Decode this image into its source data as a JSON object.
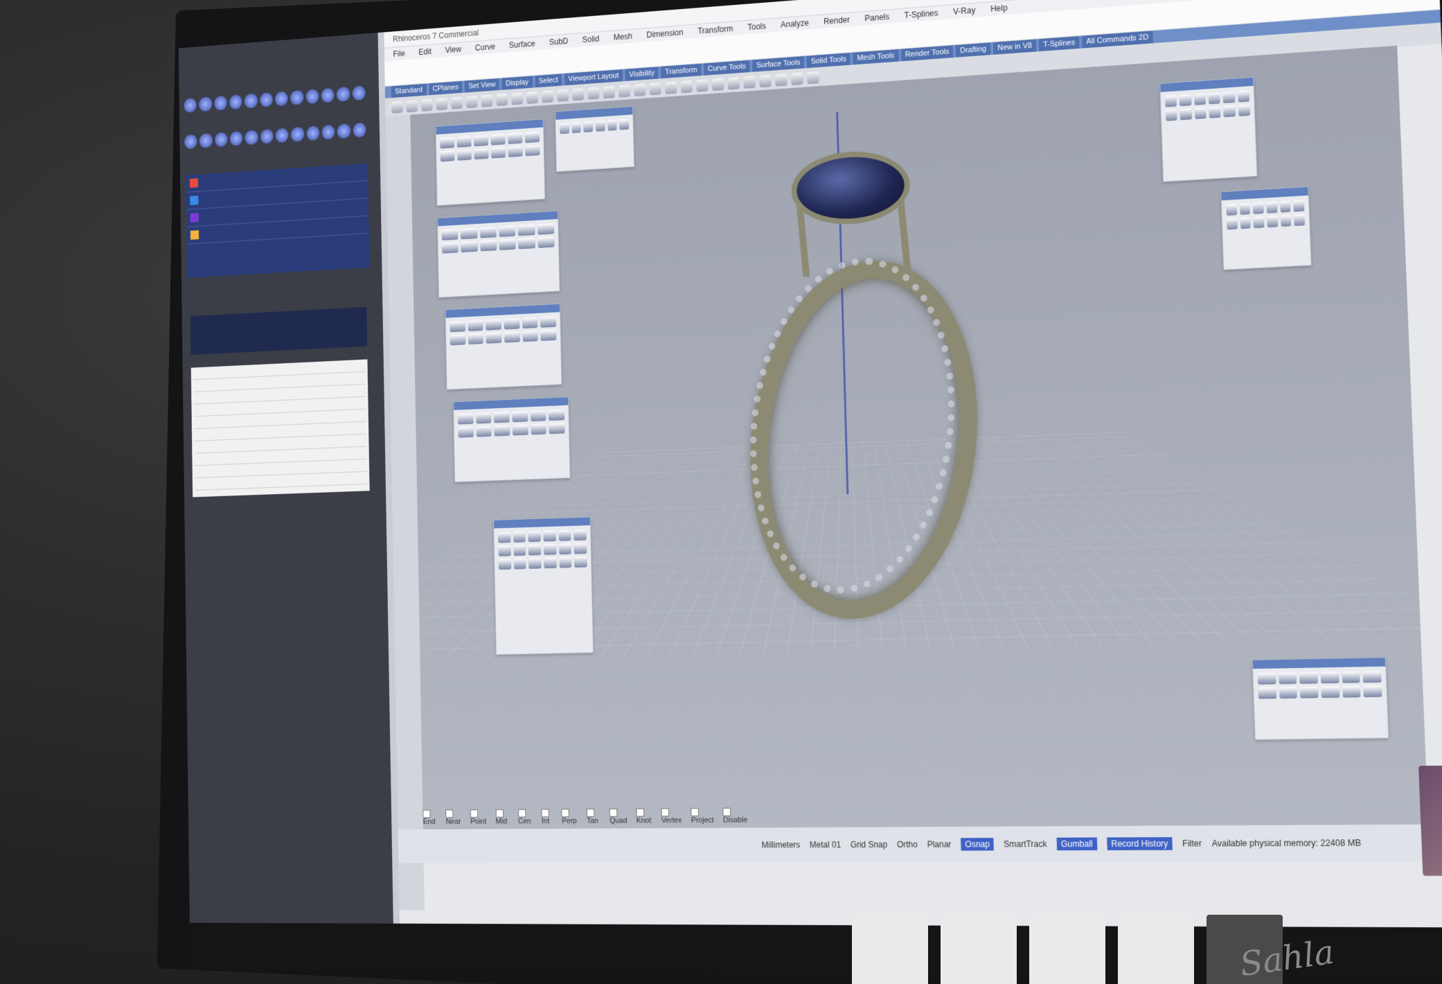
{
  "app": {
    "title": "Rhinoceros 7 Commercial"
  },
  "left_panel": {
    "warning_text": "",
    "layers": [
      {
        "color": "#e84a3a"
      },
      {
        "color": "#3a8ae8"
      },
      {
        "color": "#7a3ad8"
      },
      {
        "color": "#f2b43a"
      }
    ]
  },
  "menu": [
    "File",
    "Edit",
    "View",
    "Curve",
    "Surface",
    "SubD",
    "Solid",
    "Mesh",
    "Dimension",
    "Transform",
    "Tools",
    "Analyze",
    "Render",
    "Panels",
    "T-Splines",
    "V-Ray",
    "Help"
  ],
  "tabs": [
    "Standard",
    "CPlanes",
    "Set View",
    "Display",
    "Select",
    "Viewport Layout",
    "Visibility",
    "Transform",
    "Curve Tools",
    "Surface Tools",
    "Solid Tools",
    "Mesh Tools",
    "Render Tools",
    "Drafting",
    "New in V8",
    "T-Splines",
    "All Commands 2D"
  ],
  "statusbar": {
    "items": [
      "Grid Snap",
      "Ortho",
      "Planar",
      "Osnap",
      "SmartTrack",
      "Gumball",
      "Record History",
      "Filter"
    ],
    "active": [
      "Osnap",
      "Gumball",
      "Record History"
    ],
    "memory": "Available physical memory: 22408 MB"
  },
  "osnap": [
    "End",
    "Near",
    "Point",
    "Mid",
    "Cen",
    "Int",
    "Perp",
    "Tan",
    "Quad",
    "Knot",
    "Vertex",
    "Project",
    "Disable"
  ],
  "units": "Millimeters",
  "layer_name": "Metal 01",
  "thumbnails": [
    "",
    "",
    "",
    "",
    "",
    ""
  ],
  "logo_text": "Sahla",
  "colors": {
    "metal": "#8c8a72",
    "gem": "#1f2550",
    "viewport_bg": "#a9aeb9",
    "accent": "#3f62c6"
  },
  "icons": [
    "gear-icon",
    "layer-icon",
    "ring-object",
    "gem-object"
  ]
}
